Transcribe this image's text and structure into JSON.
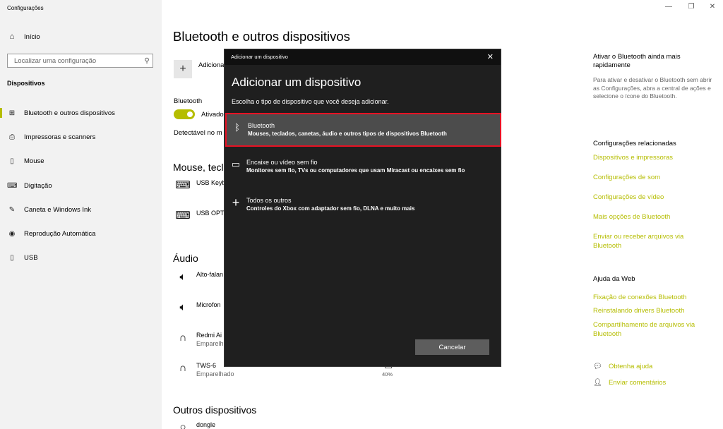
{
  "window": {
    "title": "Configurações",
    "controls": {
      "minimize": "—",
      "restore": "❐",
      "close": "✕"
    }
  },
  "sidebar": {
    "home_label": "Início",
    "search_placeholder": "Localizar uma configuração",
    "section": "Dispositivos",
    "items": [
      {
        "label": "Bluetooth e outros dispositivos",
        "icon": "bluetooth-devices-icon",
        "active": true
      },
      {
        "label": "Impressoras e scanners",
        "icon": "printer-icon"
      },
      {
        "label": "Mouse",
        "icon": "mouse-icon"
      },
      {
        "label": "Digitação",
        "icon": "keyboard-icon"
      },
      {
        "label": "Caneta e Windows Ink",
        "icon": "pen-icon"
      },
      {
        "label": "Reprodução Automática",
        "icon": "autoplay-icon"
      },
      {
        "label": "USB",
        "icon": "usb-icon"
      }
    ]
  },
  "main": {
    "title": "Bluetooth e outros dispositivos",
    "add_label": "Adiciona",
    "bluetooth_label": "Bluetooth",
    "bluetooth_state": "Ativado",
    "discoverable": "Detectável no m",
    "sections": {
      "mouse": "Mouse, tecla",
      "audio": "Áudio",
      "others": "Outros dispositivos"
    },
    "mouse_devices": [
      {
        "name": "USB Keyb"
      },
      {
        "name": "USB OPT"
      }
    ],
    "audio_devices": [
      {
        "name": "Alto-falan",
        "status": ""
      },
      {
        "name": "Microfon",
        "status": ""
      },
      {
        "name": "Redmi Ai",
        "status": "Emparelh"
      },
      {
        "name": "TWS-6",
        "status": "Emparelhado"
      }
    ],
    "battery": "40%",
    "other_devices": [
      {
        "name": "dongle"
      }
    ]
  },
  "right": {
    "bt_quick_heading": "Ativar o Bluetooth ainda mais rapidamente",
    "bt_quick_text": "Para ativar e desativar o Bluetooth sem abrir as Configurações, abra a central de ações e selecione o ícone do Bluetooth.",
    "related_heading": "Configurações relacionadas",
    "related_links": [
      "Dispositivos e impressoras",
      "Configurações de som",
      "Configurações de vídeo",
      "Mais opções de Bluetooth",
      "Enviar ou receber arquivos via Bluetooth"
    ],
    "web_heading": "Ajuda da Web",
    "web_links": [
      "Fixação de conexões Bluetooth",
      "Reinstalando drivers Bluetooth",
      "Compartilhamento de arquivos via Bluetooth"
    ],
    "help_label": "Obtenha ajuda",
    "feedback_label": "Enviar comentários"
  },
  "dialog": {
    "titlebar": "Adicionar um dispositivo",
    "heading": "Adicionar um dispositivo",
    "subtitle": "Escolha o tipo de dispositivo que você deseja adicionar.",
    "options": [
      {
        "title": "Bluetooth",
        "desc": "Mouses, teclados, canetas, áudio e outros tipos de dispositivos Bluetooth"
      },
      {
        "title": "Encaixe ou vídeo sem fio",
        "desc": "Monitores sem fio, TVs ou computadores que usam Miracast ou encaixes sem fio"
      },
      {
        "title": "Todos os outros",
        "desc": "Controles do Xbox com adaptador sem fio, DLNA e muito mais"
      }
    ],
    "cancel_label": "Cancelar"
  }
}
